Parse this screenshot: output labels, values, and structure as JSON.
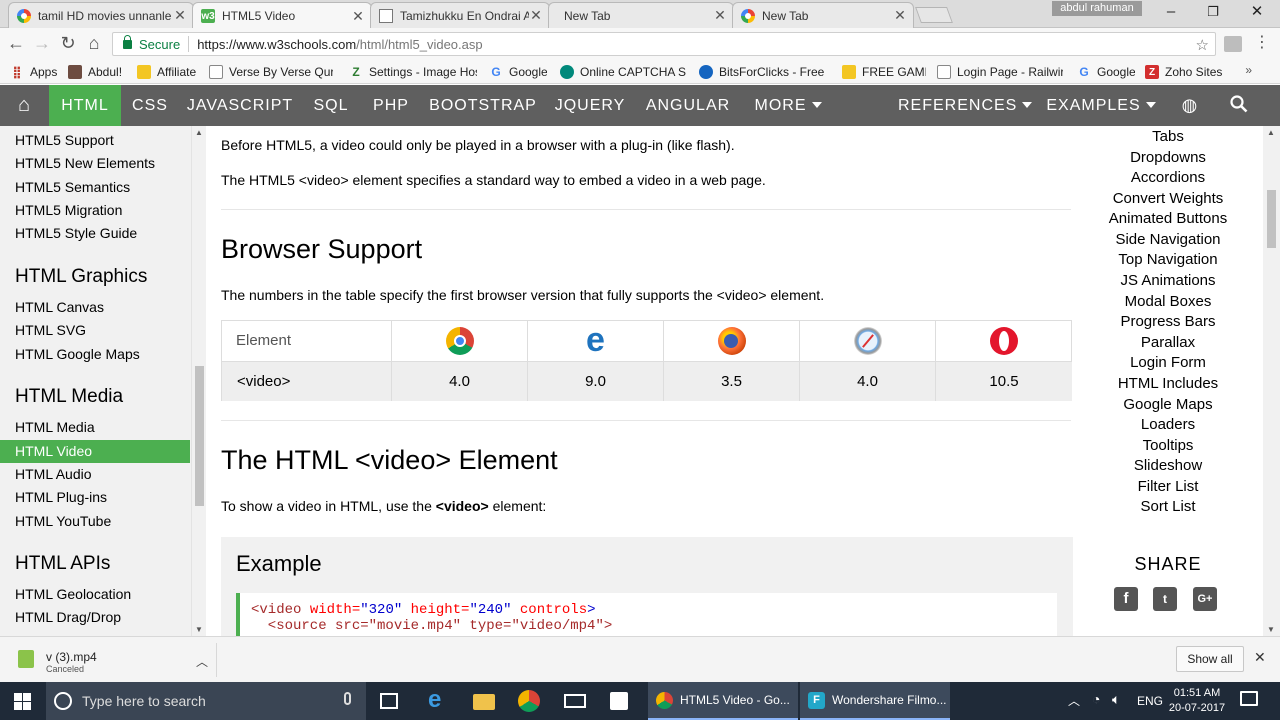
{
  "browser": {
    "tabs": [
      {
        "label": "tamil HD movies unnanle",
        "icon": "google-icon"
      },
      {
        "label": "HTML5 Video",
        "icon": "w3schools-icon",
        "active": true
      },
      {
        "label": "Tamizhukku En Ondrai A",
        "icon": "page-icon"
      },
      {
        "label": "New Tab",
        "icon": "none"
      },
      {
        "label": "New Tab",
        "icon": "google-icon"
      }
    ],
    "user": "abdul rahuman",
    "secure_label": "Secure",
    "url_scheme_host": "https://www.w3schools.com",
    "url_path": "/html/html5_video.asp",
    "bookmarks": [
      {
        "label": "Apps",
        "icon": "apps-grid-icon"
      },
      {
        "label": "Abdul!",
        "icon": "avatar-icon"
      },
      {
        "label": "Affiliate",
        "icon": "folder-icon"
      },
      {
        "label": "Verse By Verse Quran",
        "icon": "page-icon"
      },
      {
        "label": "Settings - Image Host",
        "icon": "z-icon"
      },
      {
        "label": "Google",
        "icon": "google-icon"
      },
      {
        "label": "Online CAPTCHA Sol",
        "icon": "captcha-icon"
      },
      {
        "label": "BitsForClicks - Free Bi",
        "icon": "bits-icon"
      },
      {
        "label": "FREE GAMES",
        "icon": "folder-icon"
      },
      {
        "label": "Login Page - Railwire",
        "icon": "page-icon"
      },
      {
        "label": "Google",
        "icon": "google-icon"
      },
      {
        "label": "Zoho Sites",
        "icon": "zoho-icon"
      }
    ],
    "bookmarks_more": "»"
  },
  "w3nav": {
    "items": [
      "HTML",
      "CSS",
      "JAVASCRIPT",
      "SQL",
      "PHP",
      "BOOTSTRAP",
      "JQUERY",
      "ANGULAR",
      "MORE",
      "REFERENCES",
      "EXAMPLES"
    ],
    "active": "HTML"
  },
  "sidebar": {
    "group1": [
      "HTML5 Support",
      "HTML5 New Elements",
      "HTML5 Semantics",
      "HTML5 Migration",
      "HTML5 Style Guide"
    ],
    "heading_graphics": "HTML Graphics",
    "group2": [
      "HTML Canvas",
      "HTML SVG",
      "HTML Google Maps"
    ],
    "heading_media": "HTML Media",
    "group3": [
      "HTML Media",
      "HTML Video",
      "HTML Audio",
      "HTML Plug-ins",
      "HTML YouTube"
    ],
    "heading_apis": "HTML APIs",
    "group4": [
      "HTML Geolocation",
      "HTML Drag/Drop"
    ],
    "active": "HTML Video"
  },
  "main": {
    "intro1": "Before HTML5, a video could only be played in a browser with a plug-in (like flash).",
    "intro2": "The HTML5 <video> element specifies a standard way to embed a video in a web page.",
    "support_heading": "Browser Support",
    "support_text": "The numbers in the table specify the first browser version that fully supports the <video> element.",
    "table": {
      "header_label": "Element",
      "browsers": [
        "chrome-icon",
        "edge-icon",
        "firefox-icon",
        "safari-icon",
        "opera-icon"
      ],
      "row_label": "<video>",
      "values": [
        "4.0",
        "9.0",
        "3.5",
        "4.0",
        "10.5"
      ]
    },
    "video_heading": "The HTML <video> Element",
    "video_text_pre": "To show a video in HTML, use the ",
    "video_text_tag": "<video>",
    "video_text_post": " element:",
    "example_heading": "Example",
    "code_line1_tag": "<video",
    "code_line1_attr1": " width=",
    "code_line1_val1": "\"320\"",
    "code_line1_attr2": " height=",
    "code_line1_val2": "\"240\"",
    "code_line1_attr3": " controls",
    "code_line1_end": ">",
    "code_line2": "  <source src=\"movie.mp4\" type=\"video/mp4\">"
  },
  "right_sidebar": {
    "links": [
      "Tabs",
      "Dropdowns",
      "Accordions",
      "Convert Weights",
      "Animated Buttons",
      "Side Navigation",
      "Top Navigation",
      "JS Animations",
      "Modal Boxes",
      "Progress Bars",
      "Parallax",
      "Login Form",
      "HTML Includes",
      "Google Maps",
      "Loaders",
      "Tooltips",
      "Slideshow",
      "Filter List",
      "Sort List"
    ],
    "share_label": "SHARE",
    "social": [
      "facebook-icon",
      "twitter-icon",
      "google-plus-icon"
    ]
  },
  "download_bar": {
    "file_name": "v (3).mp4",
    "status": "Canceled",
    "show_all": "Show all"
  },
  "taskbar": {
    "search_placeholder": "Type here to search",
    "tasks": [
      {
        "label": "HTML5 Video - Go...",
        "icon": "chrome-icon"
      },
      {
        "label": "Wondershare Filmo...",
        "icon": "filmora-icon"
      }
    ],
    "language": "ENG",
    "time": "01:51 AM",
    "date": "20-07-2017"
  }
}
